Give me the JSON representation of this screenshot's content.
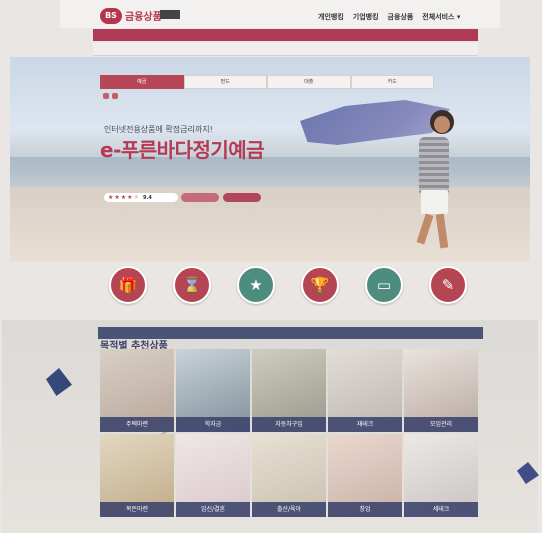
{
  "header": {
    "logo_mark": "BS",
    "logo_text": "금융상품",
    "logo_tag": "",
    "links": [
      "개인뱅킹",
      "기업뱅킹",
      "금융상품",
      "전체서비스 ▾"
    ]
  },
  "nav": {
    "items": [
      "",
      "",
      "",
      "",
      "",
      "",
      "",
      "",
      ""
    ]
  },
  "subbar": {
    "breadcrumb": "",
    "sitemap": ""
  },
  "hero": {
    "tabs": [
      "예금",
      "펀드",
      "대출",
      "카드"
    ],
    "active_tab": 0,
    "pills": [
      "",
      ""
    ],
    "subtitle": "인터넷전용상품에 확정금리까지!",
    "title": "e-푸른바다정기예금",
    "description": "",
    "rating_stars": 4,
    "rating_max": 5,
    "score": "9.4",
    "btn_a": "",
    "btn_b": ""
  },
  "categories": [
    {
      "label": "",
      "color": "#b44552",
      "icon": "gift-icon",
      "glyph": "🎁"
    },
    {
      "label": "",
      "color": "#b44552",
      "icon": "hourglass-icon",
      "glyph": "⌛"
    },
    {
      "label": "",
      "color": "#4e8c7f",
      "icon": "star-icon",
      "glyph": "★"
    },
    {
      "label": "",
      "color": "#b44552",
      "icon": "trophy-icon",
      "glyph": "🏆"
    },
    {
      "label": "",
      "color": "#4e8c7f",
      "icon": "monitor-icon",
      "glyph": "▭"
    },
    {
      "label": "",
      "color": "#b44552",
      "icon": "wand-icon",
      "glyph": "✎"
    }
  ],
  "darkbar": {
    "items": [
      "",
      "",
      "",
      ""
    ],
    "right_items": [
      "",
      "",
      ""
    ]
  },
  "section": {
    "title": "목적별 추천상품",
    "subtitle": ""
  },
  "products": [
    {
      "caption": "주택마련",
      "bg": "#b9a79a",
      "tint": "#d8cfc5"
    },
    {
      "caption": "학자금",
      "bg": "#7f8f9a",
      "tint": "#c9d3d8"
    },
    {
      "caption": "자동차구입",
      "bg": "#9a988c",
      "tint": "#cfcdbf"
    },
    {
      "caption": "재테크",
      "bg": "#bdb6b0",
      "tint": "#e3ddd7"
    },
    {
      "caption": "모임관리",
      "bg": "#b9a9a2",
      "tint": "#e9e2dd"
    },
    {
      "caption": "목돈마련",
      "bg": "#c0ab89",
      "tint": "#e3d7c1"
    },
    {
      "caption": "임신/결혼",
      "bg": "#d9c8cc",
      "tint": "#efe6e7"
    },
    {
      "caption": "출산/육아",
      "bg": "#c9bfae",
      "tint": "#e7e1d4"
    },
    {
      "caption": "창업",
      "bg": "#c8b1a8",
      "tint": "#ead8cd"
    },
    {
      "caption": "세테크",
      "bg": "#c9c4c3",
      "tint": "#ece8e5"
    }
  ]
}
